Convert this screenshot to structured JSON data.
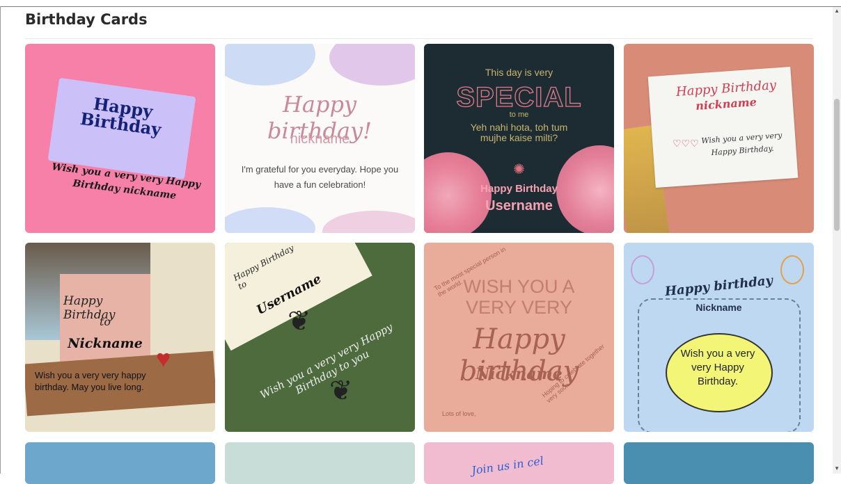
{
  "section": {
    "title": "Birthday Cards"
  },
  "cards": [
    {
      "title": "Happy Birthday",
      "message": "Wish you a very very Happy Birthday nickname"
    },
    {
      "title": "Happy birthday!",
      "nickname": "nickname",
      "message": "I'm grateful for you everyday. Hope you have a fun celebration!"
    },
    {
      "line1": "This day is very",
      "special": "SPECIAL",
      "tome": "to me",
      "urdu": "Yeh nahi hota, toh tum mujhe kaise milti?",
      "hb": "Happy Birthday",
      "username": "Username"
    },
    {
      "title": "Happy Birthday",
      "nickname": "nickname",
      "message": "Wish you a very very Happy Birthday."
    },
    {
      "title": "Happy Birthday",
      "to": "to",
      "nickname": "Nickname",
      "message": "Wish you a very very happy birthday. May you live long."
    },
    {
      "title": "Happy Birthday to",
      "username": "Username",
      "message": "Wish you a very very Happy Birthday to you"
    },
    {
      "wish": "WISH YOU A VERY VERY",
      "hb": "Happy birthday",
      "nickname": "Nickname",
      "circ1": "To the most special person in the world.",
      "circ2": "Hoping to celebrate together very soon",
      "love": "Lots of love,"
    },
    {
      "title": "Happy birthday",
      "nickname": "Nickname",
      "message": "Wish you a very very Happy Birthday."
    },
    {
      "text": ""
    },
    {
      "text": ""
    },
    {
      "join": "Join us in cel"
    },
    {
      "text": ""
    }
  ],
  "scrollbar": {
    "up": "▲",
    "down": "▼"
  }
}
